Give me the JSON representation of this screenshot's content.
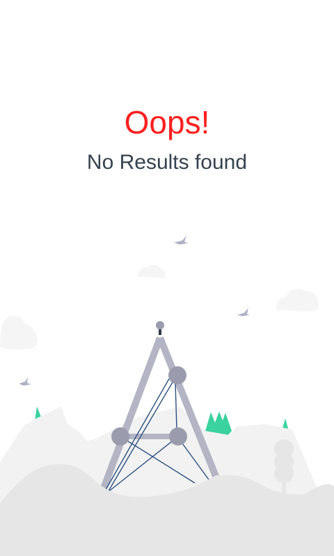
{
  "empty_state": {
    "title": "Oops!",
    "message": "No Results found",
    "title_color": "#ff1f1f",
    "illustration": "signal-tower-landscape"
  }
}
